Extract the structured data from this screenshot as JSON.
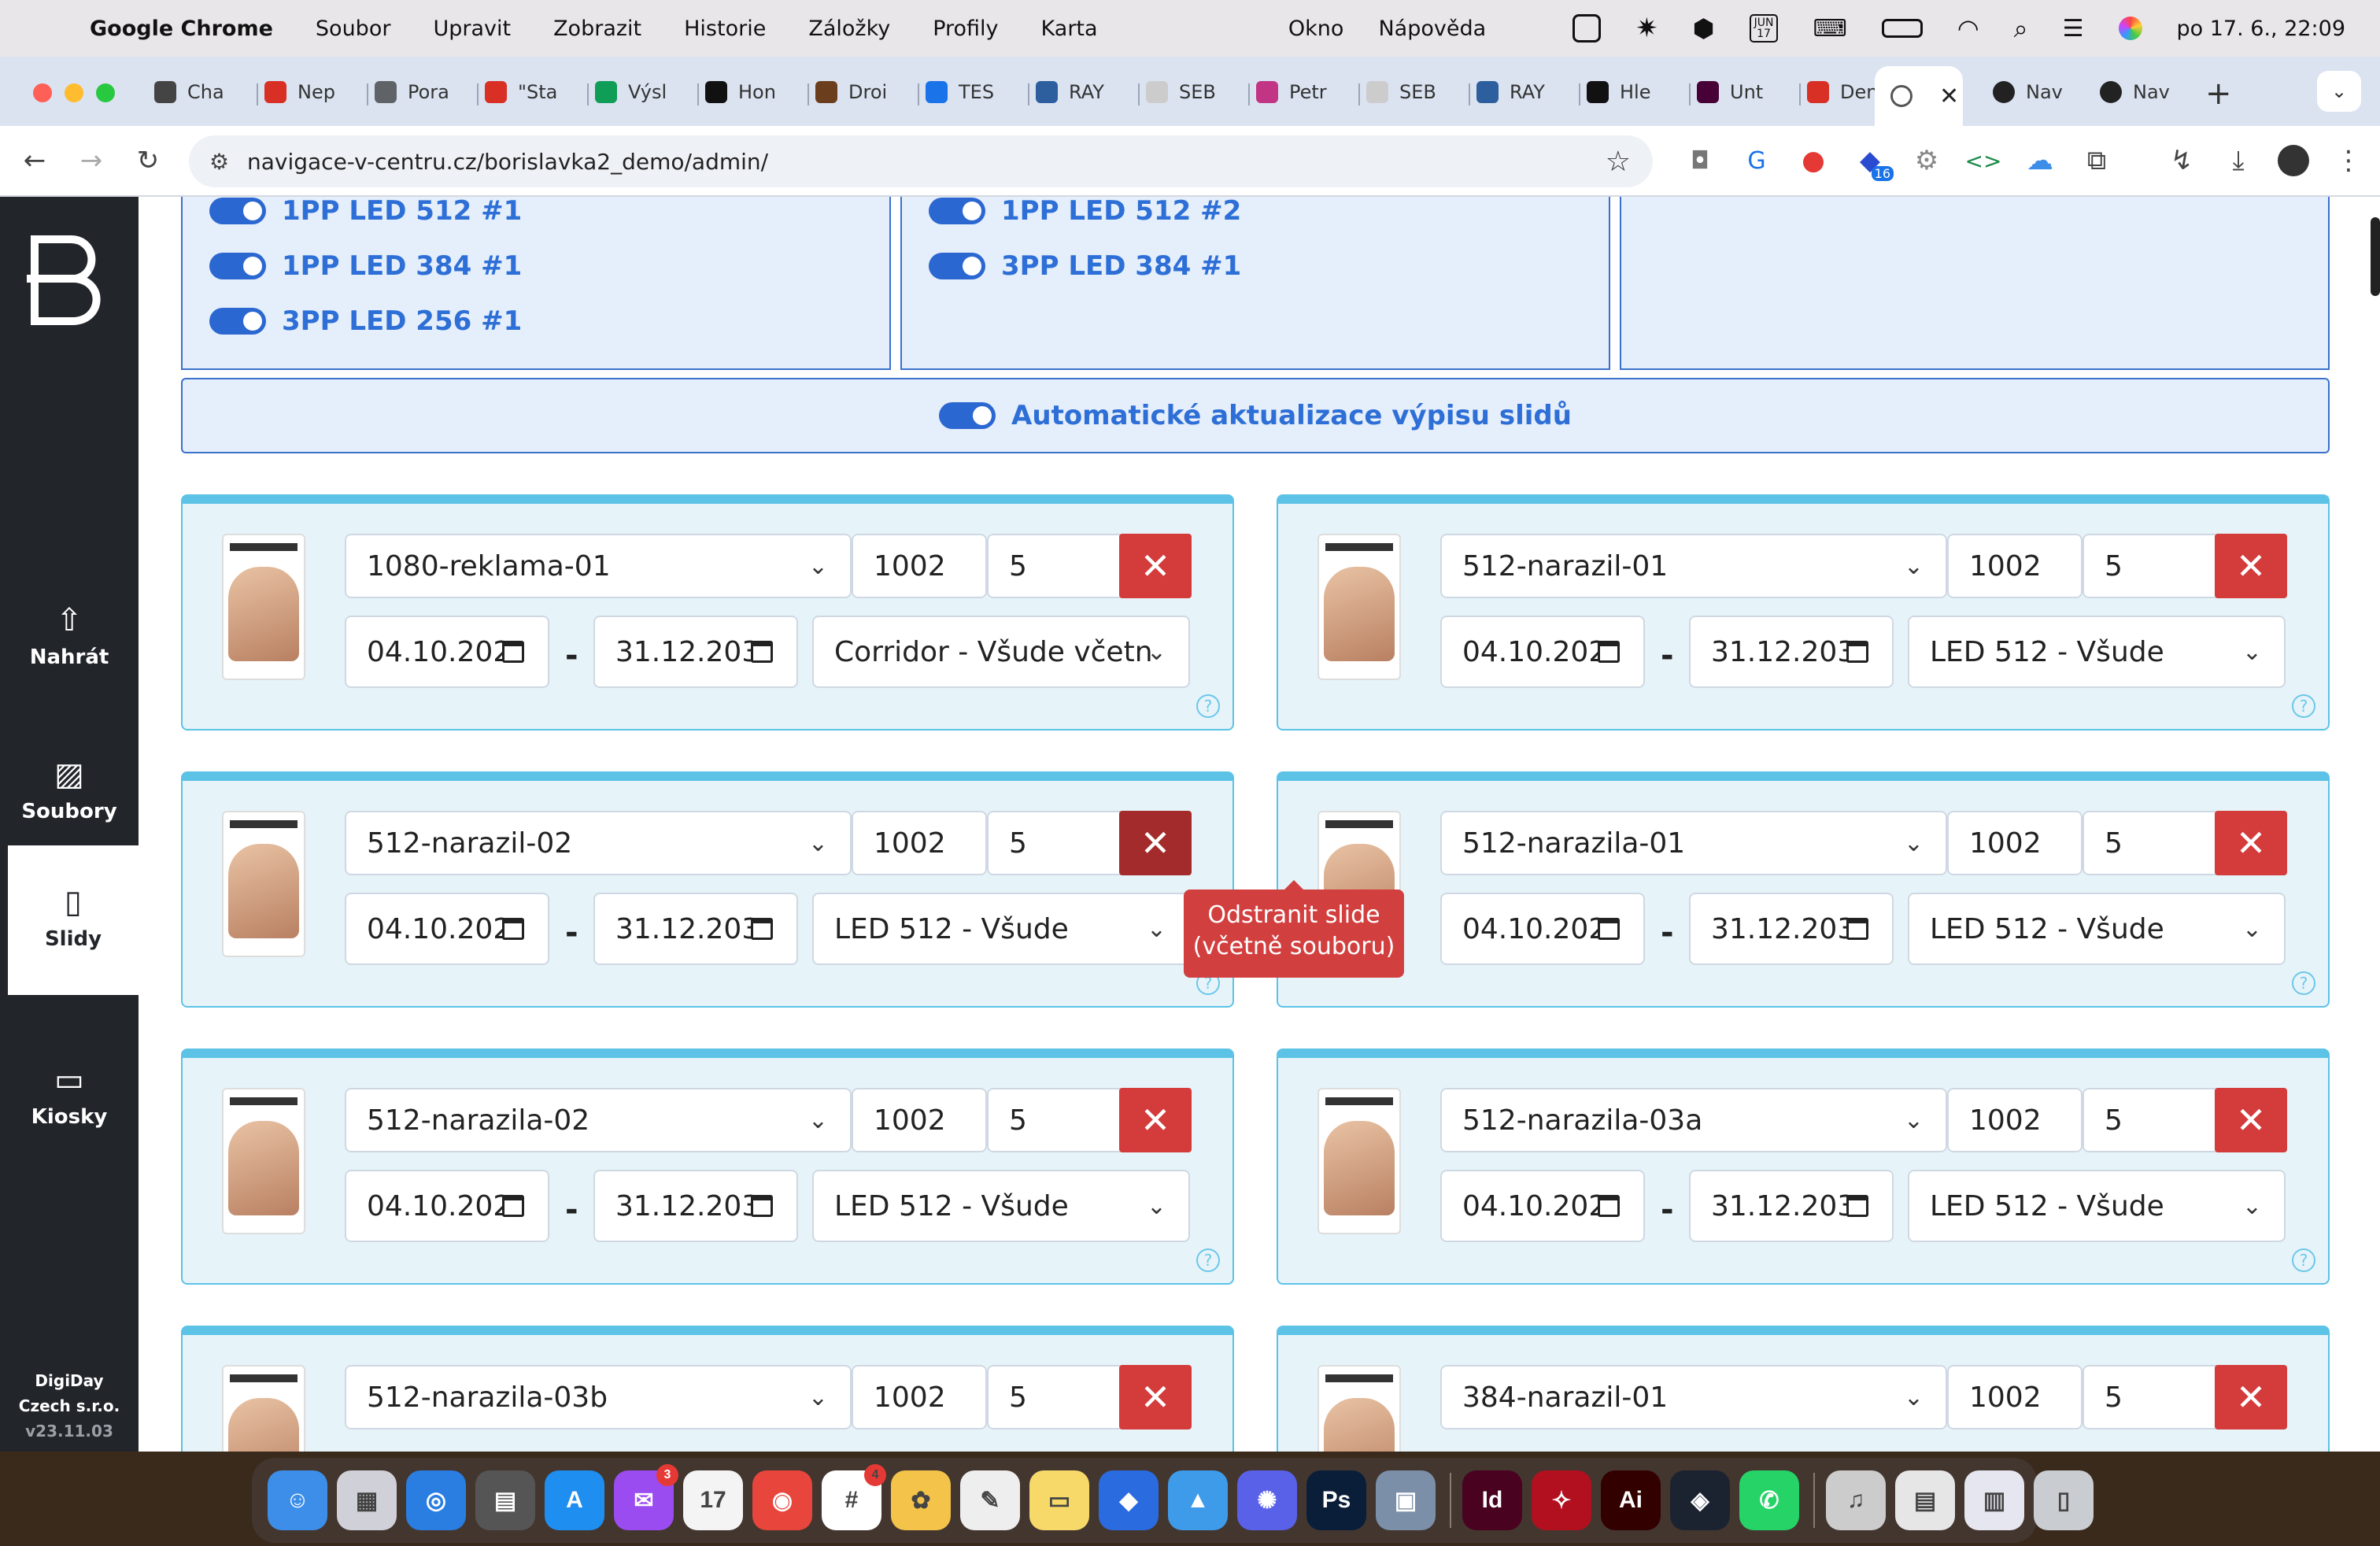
{
  "menubar": {
    "app": "Google Chrome",
    "items": [
      "Soubor",
      "Upravit",
      "Zobrazit",
      "Historie",
      "Záložky",
      "Profily",
      "Karta"
    ],
    "right_items": [
      "Okno",
      "Nápověda"
    ],
    "calendar_icon_label": "JUN\n17",
    "datetime": "po 17. 6., 22:09"
  },
  "tabs": [
    {
      "label": "Cha",
      "color": "#444444",
      "icon": "openai-icon"
    },
    {
      "label": "Nep",
      "color": "#d93025",
      "icon": "gmail-icon"
    },
    {
      "label": "Pora",
      "color": "#5f6368",
      "icon": "book-icon"
    },
    {
      "label": "\"Sta",
      "color": "#d93025",
      "icon": "gmail-icon"
    },
    {
      "label": "Výsl",
      "color": "#0f9d58",
      "icon": "drive-icon"
    },
    {
      "label": "Hon",
      "color": "#111111",
      "icon": "circle-icon"
    },
    {
      "label": "Droi",
      "color": "#6b3f1d",
      "icon": "droid-icon"
    },
    {
      "label": "TES",
      "color": "#1a73e8",
      "icon": "cube-icon"
    },
    {
      "label": "RAY",
      "color": "#2d5e9e",
      "icon": "plane-icon"
    },
    {
      "label": "SEB",
      "color": "#cccccc",
      "icon": "blank-icon"
    },
    {
      "label": "Petr",
      "color": "#c13584",
      "icon": "instagram-icon"
    },
    {
      "label": "SEB",
      "color": "#cccccc",
      "icon": "blank-icon"
    },
    {
      "label": "RAY",
      "color": "#2d5e9e",
      "icon": "plane-icon"
    },
    {
      "label": "Hle",
      "color": "#111111",
      "icon": "vm-icon"
    },
    {
      "label": "Unt",
      "color": "#470137",
      "icon": "xd-icon"
    },
    {
      "label": "Den",
      "color": "#d93025",
      "icon": "gmail-icon"
    }
  ],
  "tabs_after": [
    {
      "label": "Nav",
      "color": "#222222",
      "icon": "globe-icon"
    },
    {
      "label": "Nav",
      "color": "#222222",
      "icon": "globe-icon"
    }
  ],
  "toolbar": {
    "url": "navigace-v-centru.cz/borislavka2_demo/admin/",
    "extension_badge": "16"
  },
  "sidebar": {
    "items": [
      {
        "label": "Nahrát",
        "icon": "upload-icon",
        "active": false
      },
      {
        "label": "Soubory",
        "icon": "image-icon",
        "active": false
      },
      {
        "label": "Slidy",
        "icon": "slide-icon",
        "active": true
      },
      {
        "label": "Kiosky",
        "icon": "monitor-icon",
        "active": false
      }
    ],
    "company_line1": "DigiDay",
    "company_line2": "Czech s.r.o.",
    "version": "v23.11.03"
  },
  "groups": [
    [
      "1PP LED 512 #1",
      "1PP LED 384 #1",
      "3PP LED 256 #1"
    ],
    [
      "1PP LED 512 #2",
      "3PP LED 384 #1"
    ],
    []
  ],
  "auto_update_label": "Automatické aktualizace výpisu slidů",
  "slides": [
    {
      "name": "1080-reklama-01",
      "id": "1002",
      "duration": "5",
      "from": "04.10.202",
      "to": "31.12.203",
      "target": "Corridor - Všude včetn"
    },
    {
      "name": "512-narazil-01",
      "id": "1002",
      "duration": "5",
      "from": "04.10.202",
      "to": "31.12.203",
      "target": "LED 512 - Všude"
    },
    {
      "name": "512-narazil-02",
      "id": "1002",
      "duration": "5",
      "from": "04.10.202",
      "to": "31.12.203",
      "target": "LED 512 - Všude"
    },
    {
      "name": "512-narazila-01",
      "id": "1002",
      "duration": "5",
      "from": "04.10.202",
      "to": "31.12.203",
      "target": "LED 512 - Všude"
    },
    {
      "name": "512-narazila-02",
      "id": "1002",
      "duration": "5",
      "from": "04.10.202",
      "to": "31.12.203",
      "target": "LED 512 - Všude"
    },
    {
      "name": "512-narazila-03a",
      "id": "1002",
      "duration": "5",
      "from": "04.10.202",
      "to": "31.12.203",
      "target": "LED 512 - Všude"
    },
    {
      "name": "512-narazila-03b",
      "id": "1002",
      "duration": "5",
      "from": "",
      "to": "",
      "target": ""
    },
    {
      "name": "384-narazil-01",
      "id": "1002",
      "duration": "5",
      "from": "",
      "to": "",
      "target": ""
    }
  ],
  "tooltip": {
    "line1": "Odstranit slide",
    "line2": "(včetně souboru)"
  },
  "dock": [
    {
      "name": "finder-icon",
      "color": "#3d8ee8",
      "glyph": "☺"
    },
    {
      "name": "launchpad-icon",
      "color": "#d0d0d8",
      "glyph": "▦"
    },
    {
      "name": "safari-icon",
      "color": "#2a7de1",
      "glyph": "◎"
    },
    {
      "name": "calculator-icon",
      "color": "#555555",
      "glyph": "▤"
    },
    {
      "name": "app-store-icon",
      "color": "#1e8ef0",
      "glyph": "A"
    },
    {
      "name": "messenger-icon",
      "color": "#9b4cf0",
      "glyph": "✉",
      "badge": "3"
    },
    {
      "name": "calendar-icon",
      "color": "#f4f4f4",
      "glyph": "17"
    },
    {
      "name": "chrome-icon",
      "color": "#e8453c",
      "glyph": "◉"
    },
    {
      "name": "slack-icon",
      "color": "#ffffff",
      "glyph": "#",
      "badge": "4"
    },
    {
      "name": "photos-icon",
      "color": "#f3c34a",
      "glyph": "✿"
    },
    {
      "name": "textedit-icon",
      "color": "#eeeeee",
      "glyph": "✎"
    },
    {
      "name": "notes-icon",
      "color": "#f7d96a",
      "glyph": "▭"
    },
    {
      "name": "keynote-icon",
      "color": "#2b6be0",
      "glyph": "◆"
    },
    {
      "name": "testflight-icon",
      "color": "#3d9be9",
      "glyph": "▲"
    },
    {
      "name": "gear-app-icon",
      "color": "#5961e8",
      "glyph": "✺"
    },
    {
      "name": "photoshop-icon",
      "color": "#0a1e3a",
      "glyph": "Ps"
    },
    {
      "name": "preview-icon",
      "color": "#7b8fa8",
      "glyph": "▣"
    },
    {
      "name": "indesign-icon",
      "color": "#49021f",
      "glyph": "Id"
    },
    {
      "name": "acrobat-icon",
      "color": "#b3101f",
      "glyph": "✧"
    },
    {
      "name": "illustrator-icon",
      "color": "#330000",
      "glyph": "Ai"
    },
    {
      "name": "cursor-app-icon",
      "color": "#1b2330",
      "glyph": "◈"
    },
    {
      "name": "whatsapp-icon",
      "color": "#25d366",
      "glyph": "✆"
    },
    {
      "name": "music-icon",
      "color": "#cccccc",
      "glyph": "♫"
    },
    {
      "name": "window-thumb-1-icon",
      "color": "#e6e6e6",
      "glyph": "▤"
    },
    {
      "name": "window-thumb-2-icon",
      "color": "#e6e6f0",
      "glyph": "▥"
    },
    {
      "name": "trash-icon",
      "color": "#c9ccd1",
      "glyph": "▯"
    }
  ]
}
